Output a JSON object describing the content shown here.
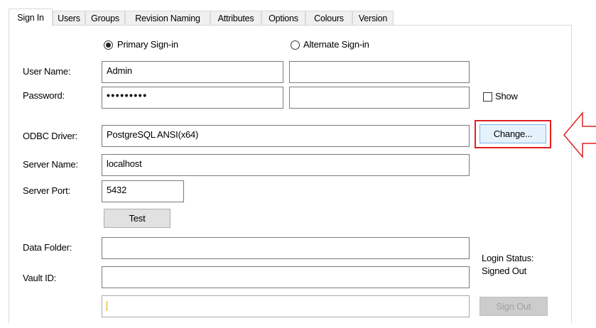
{
  "tabs": [
    {
      "label": "Sign In",
      "active": true
    },
    {
      "label": "Users",
      "active": false
    },
    {
      "label": "Groups",
      "active": false
    },
    {
      "label": "Revision Naming",
      "active": false
    },
    {
      "label": "Attributes",
      "active": false
    },
    {
      "label": "Options",
      "active": false
    },
    {
      "label": "Colours",
      "active": false
    },
    {
      "label": "Version",
      "active": false
    }
  ],
  "signin": {
    "primary_label": "Primary Sign-in",
    "primary_selected": true,
    "alternate_label": "Alternate Sign-in",
    "alternate_selected": false,
    "username_label": "User Name:",
    "username_value": "Admin",
    "alt_username_value": "",
    "password_label": "Password:",
    "password_value": "•••••••••",
    "alt_password_value": "",
    "show_label": "Show",
    "show_checked": false,
    "odbc_label": "ODBC Driver:",
    "odbc_value": "PostgreSQL ANSI(x64)",
    "change_label": "Change...",
    "server_name_label": "Server Name:",
    "server_name_value": "localhost",
    "server_port_label": "Server Port:",
    "server_port_value": "5432",
    "test_label": "Test",
    "data_folder_label": "Data Folder:",
    "data_folder_value": "",
    "vault_id_label": "Vault ID:",
    "vault_id_value": "",
    "bottom_field_value": "",
    "login_status_label": "Login Status:",
    "login_status_value": "Signed Out",
    "signout_label": "Sign Out"
  },
  "colors": {
    "highlight": "#e02020",
    "button_bg": "#e1e1e1",
    "button_focus_bg": "#e5f1fb",
    "disabled_text": "#a0a0a0"
  }
}
